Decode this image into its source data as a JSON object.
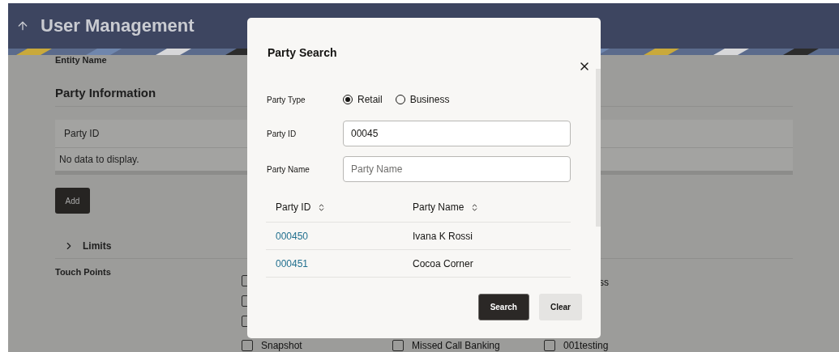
{
  "header": {
    "title": "User Management"
  },
  "page": {
    "entity_label": "Entity Name",
    "section_title": "Party Information",
    "table": {
      "columns": [
        "Party ID"
      ],
      "empty_text": "No data to display."
    },
    "add_button": "Add",
    "limits": {
      "label": "Limits",
      "expanded": false
    },
    "touch_points": {
      "label": "Touch Points",
      "rows": [
        {
          "items": [
            {
              "kind": "checkbox",
              "checked": false
            },
            {
              "kind": "covered"
            },
            {
              "kind": "fragment",
              "label": "ss"
            }
          ]
        },
        {
          "items": [
            {
              "kind": "checkbox",
              "checked": false
            }
          ]
        },
        {
          "items": [
            {
              "kind": "checkbox",
              "checked": false
            }
          ]
        },
        {
          "items": [
            {
              "kind": "checkbox",
              "label": "Snapshot",
              "checked": false
            },
            {
              "kind": "checkbox",
              "label": "Missed Call Banking",
              "checked": false
            },
            {
              "kind": "checkbox",
              "label": "001testing",
              "checked": false
            }
          ]
        }
      ]
    }
  },
  "dialog": {
    "title": "Party Search",
    "party_type": {
      "label": "Party Type",
      "options": [
        {
          "label": "Retail",
          "selected": true
        },
        {
          "label": "Business",
          "selected": false
        }
      ]
    },
    "fields": [
      {
        "label": "Party ID",
        "value": "00045"
      },
      {
        "label": "Party Name",
        "placeholder": "Party Name"
      }
    ],
    "results": {
      "columns": [
        "Party ID",
        "Party Name"
      ],
      "rows": [
        {
          "party_id": "000450",
          "party_name": "Ivana K Rossi"
        },
        {
          "party_id": "000451",
          "party_name": "Cocoa Corner"
        }
      ]
    },
    "buttons": [
      {
        "kind": "primary",
        "label": "Search"
      },
      {
        "kind": "secondary",
        "label": "Clear"
      }
    ]
  }
}
